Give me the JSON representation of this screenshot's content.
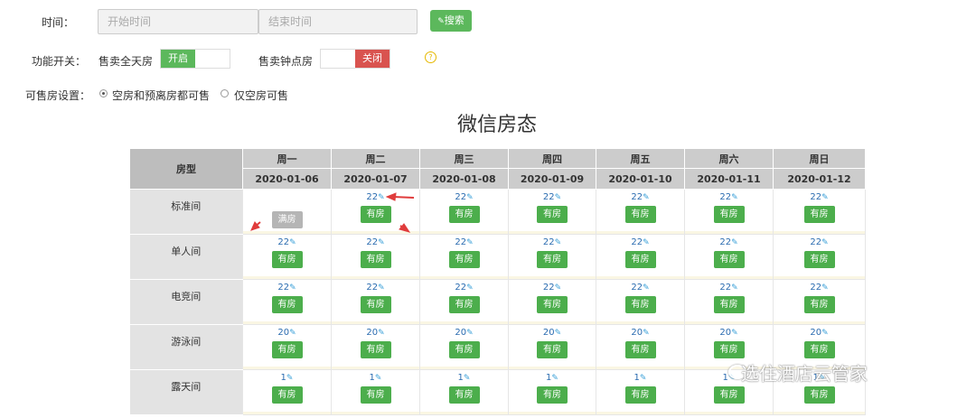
{
  "filters": {
    "time_label": "时间：",
    "start_placeholder": "开始时间",
    "end_placeholder": "结束时间",
    "search_label": "搜索",
    "search_icon": "pencil-icon"
  },
  "switches": {
    "label": "功能开关：",
    "allday_label": "售卖全天房",
    "allday_state": "开启",
    "hourly_label": "售卖钟点房",
    "hourly_state": "关闭",
    "help_glyph": "?"
  },
  "sale_setting": {
    "label": "可售房设置：",
    "option1": "空房和预离房都可售",
    "option2": "仅空房可售",
    "selected": "option1"
  },
  "title": "微信房态",
  "table": {
    "type_header": "房型",
    "days": [
      "周一",
      "周二",
      "周三",
      "周四",
      "周五",
      "周六",
      "周日"
    ],
    "dates": [
      "2020-01-06",
      "2020-01-07",
      "2020-01-08",
      "2020-01-09",
      "2020-01-10",
      "2020-01-11",
      "2020-01-12"
    ],
    "rows": [
      {
        "name": "标准间",
        "cells": [
          {
            "count": "",
            "status": "满房",
            "full": true
          },
          {
            "count": "22",
            "status": "有房"
          },
          {
            "count": "22",
            "status": "有房"
          },
          {
            "count": "22",
            "status": "有房"
          },
          {
            "count": "22",
            "status": "有房"
          },
          {
            "count": "22",
            "status": "有房"
          },
          {
            "count": "22",
            "status": "有房"
          }
        ]
      },
      {
        "name": "单人间",
        "cells": [
          {
            "count": "22",
            "status": "有房"
          },
          {
            "count": "22",
            "status": "有房"
          },
          {
            "count": "22",
            "status": "有房"
          },
          {
            "count": "22",
            "status": "有房"
          },
          {
            "count": "22",
            "status": "有房"
          },
          {
            "count": "22",
            "status": "有房"
          },
          {
            "count": "22",
            "status": "有房"
          }
        ]
      },
      {
        "name": "电竞间",
        "cells": [
          {
            "count": "22",
            "status": "有房"
          },
          {
            "count": "22",
            "status": "有房"
          },
          {
            "count": "22",
            "status": "有房"
          },
          {
            "count": "22",
            "status": "有房"
          },
          {
            "count": "22",
            "status": "有房"
          },
          {
            "count": "22",
            "status": "有房"
          },
          {
            "count": "22",
            "status": "有房"
          }
        ]
      },
      {
        "name": "游泳间",
        "cells": [
          {
            "count": "20",
            "status": "有房"
          },
          {
            "count": "20",
            "status": "有房"
          },
          {
            "count": "20",
            "status": "有房"
          },
          {
            "count": "20",
            "status": "有房"
          },
          {
            "count": "20",
            "status": "有房"
          },
          {
            "count": "20",
            "status": "有房"
          },
          {
            "count": "20",
            "status": "有房"
          }
        ]
      },
      {
        "name": "露天间",
        "cells": [
          {
            "count": "1",
            "status": "有房"
          },
          {
            "count": "1",
            "status": "有房"
          },
          {
            "count": "1",
            "status": "有房"
          },
          {
            "count": "1",
            "status": "有房"
          },
          {
            "count": "1",
            "status": "有房"
          },
          {
            "count": "1",
            "status": "有房"
          },
          {
            "count": "1",
            "status": "有房"
          }
        ]
      }
    ]
  },
  "watermark": "选住酒店云管家",
  "colors": {
    "green": "#5cb85c",
    "red": "#d9534f",
    "arrow": "#e03c3c",
    "header": "#cccccc"
  }
}
